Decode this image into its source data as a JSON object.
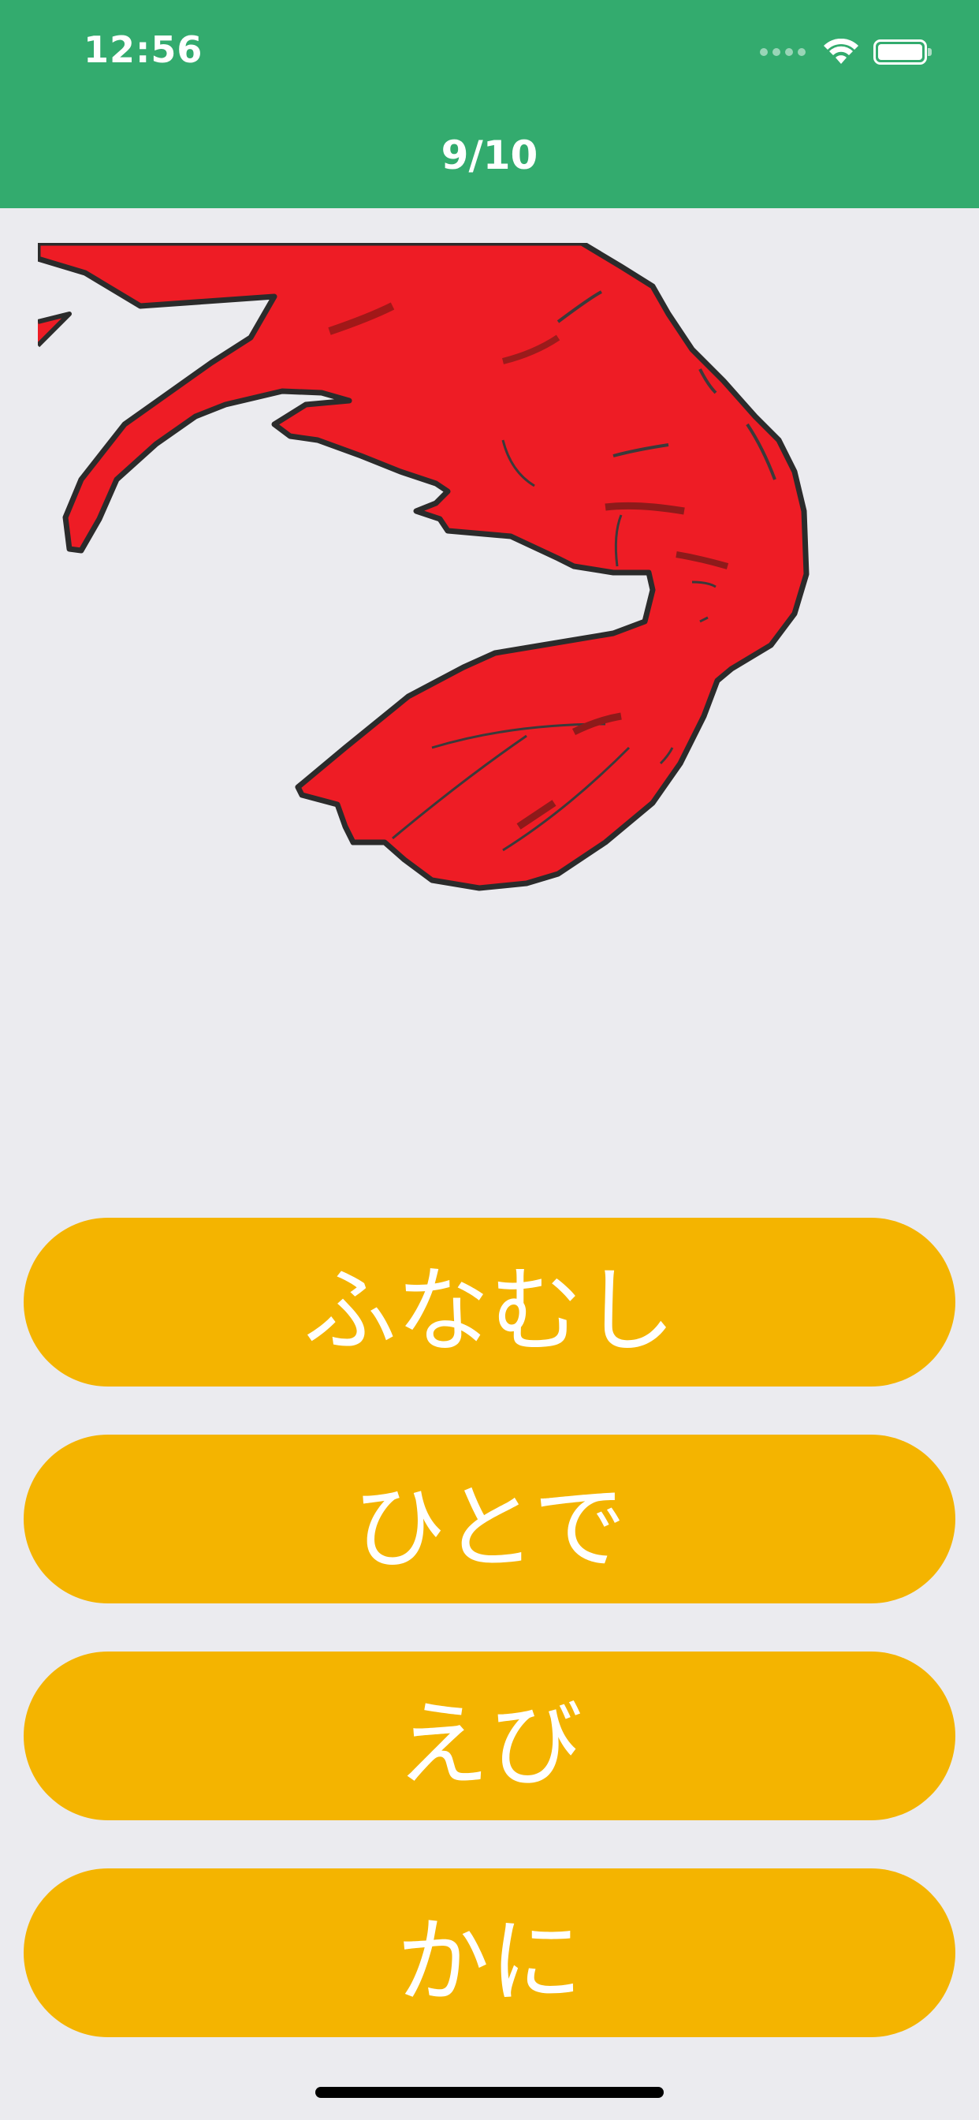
{
  "status_bar": {
    "time": "12:56"
  },
  "header": {
    "progress": "9/10"
  },
  "question": {
    "image": "red-shrimp-illustration"
  },
  "answers": [
    {
      "label": "ふなむし"
    },
    {
      "label": "ひとで"
    },
    {
      "label": "えび"
    },
    {
      "label": "かに"
    }
  ],
  "colors": {
    "header": "#33ab6e",
    "background": "#ebebef",
    "button": "#f4b400",
    "button_text": "#ffffff",
    "shrimp": "#ee1c25"
  }
}
